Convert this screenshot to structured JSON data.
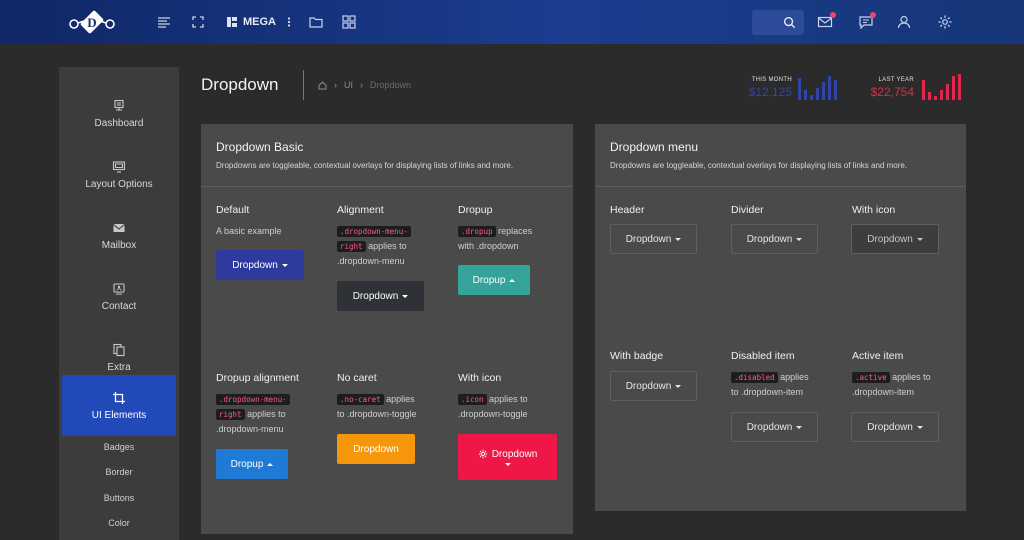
{
  "header": {
    "mega_label": "MEGA"
  },
  "sidebar": {
    "items": [
      {
        "label": "Dashboard",
        "icon": "monitor-icon"
      },
      {
        "label": "Layout Options",
        "icon": "layout-icon"
      },
      {
        "label": "Mailbox",
        "icon": "mail-icon"
      },
      {
        "label": "Contact",
        "icon": "contact-icon"
      },
      {
        "label": "Extra",
        "icon": "copy-icon"
      },
      {
        "label": "UI Elements",
        "icon": "crop-icon"
      }
    ],
    "subitems": [
      "Badges",
      "Border",
      "Buttons",
      "Color"
    ]
  },
  "page": {
    "title": "Dropdown",
    "breadcrumb": [
      "UI",
      "Dropdown"
    ]
  },
  "stats": {
    "this_month": {
      "label": "THIS MONTH",
      "value": "$12,125",
      "color": "#3344a8"
    },
    "last_year": {
      "label": "LAST YEAR",
      "value": "$22,754",
      "color": "#e0284f"
    }
  },
  "basic": {
    "title": "Dropdown Basic",
    "subtitle": "Dropdowns are toggleable, contextual overlays for displaying lists of links and more.",
    "default": {
      "title": "Default",
      "desc": "A basic example",
      "button": "Dropdown"
    },
    "alignment": {
      "title": "Alignment",
      "code": ".dropdown-menu-right",
      "code_a": ".dropdown-menu-",
      "code_b": "right",
      "desc": "applies to .dropdown-menu",
      "desc_a": "applies to",
      "desc_b": ".dropdown-menu",
      "button": "Dropdown"
    },
    "dropup": {
      "title": "Dropup",
      "code": ".dropup",
      "desc_a": "replaces",
      "desc_b": "with .dropdown",
      "button": "Dropup"
    },
    "dropup_alignment": {
      "title": "Dropup alignment",
      "code_a": ".dropdown-menu-",
      "code_b": "right",
      "desc_a": "applies to",
      "desc_b": ".dropdown-menu",
      "button": "Dropup"
    },
    "no_caret": {
      "title": "No caret",
      "code": ".no-caret",
      "desc_a": "applies",
      "desc_b": "to .dropdown-toggle",
      "button": "Dropdown"
    },
    "with_icon": {
      "title": "With icon",
      "code": ".icon",
      "desc_a": "applies to",
      "desc_b": ".dropdown-toggle",
      "button": "Dropdown"
    }
  },
  "menu": {
    "title": "Dropdown menu",
    "subtitle": "Dropdowns are toggleable, contextual overlays for displaying lists of links and more.",
    "header": {
      "title": "Header",
      "button": "Dropdown"
    },
    "divider": {
      "title": "Divider",
      "button": "Dropdown"
    },
    "with_icon": {
      "title": "With icon",
      "button": "Dropdown"
    },
    "with_badge": {
      "title": "With badge",
      "button": "Dropdown"
    },
    "disabled_item": {
      "title": "Disabled item",
      "code": ".disabled",
      "desc_a": "applies",
      "desc_b": "to .dropdown-item",
      "button": "Dropdown"
    },
    "active_item": {
      "title": "Active item",
      "code": ".active",
      "desc_a": "applies to",
      "desc_b": ".dropdown-item",
      "button": "Dropdown"
    }
  }
}
